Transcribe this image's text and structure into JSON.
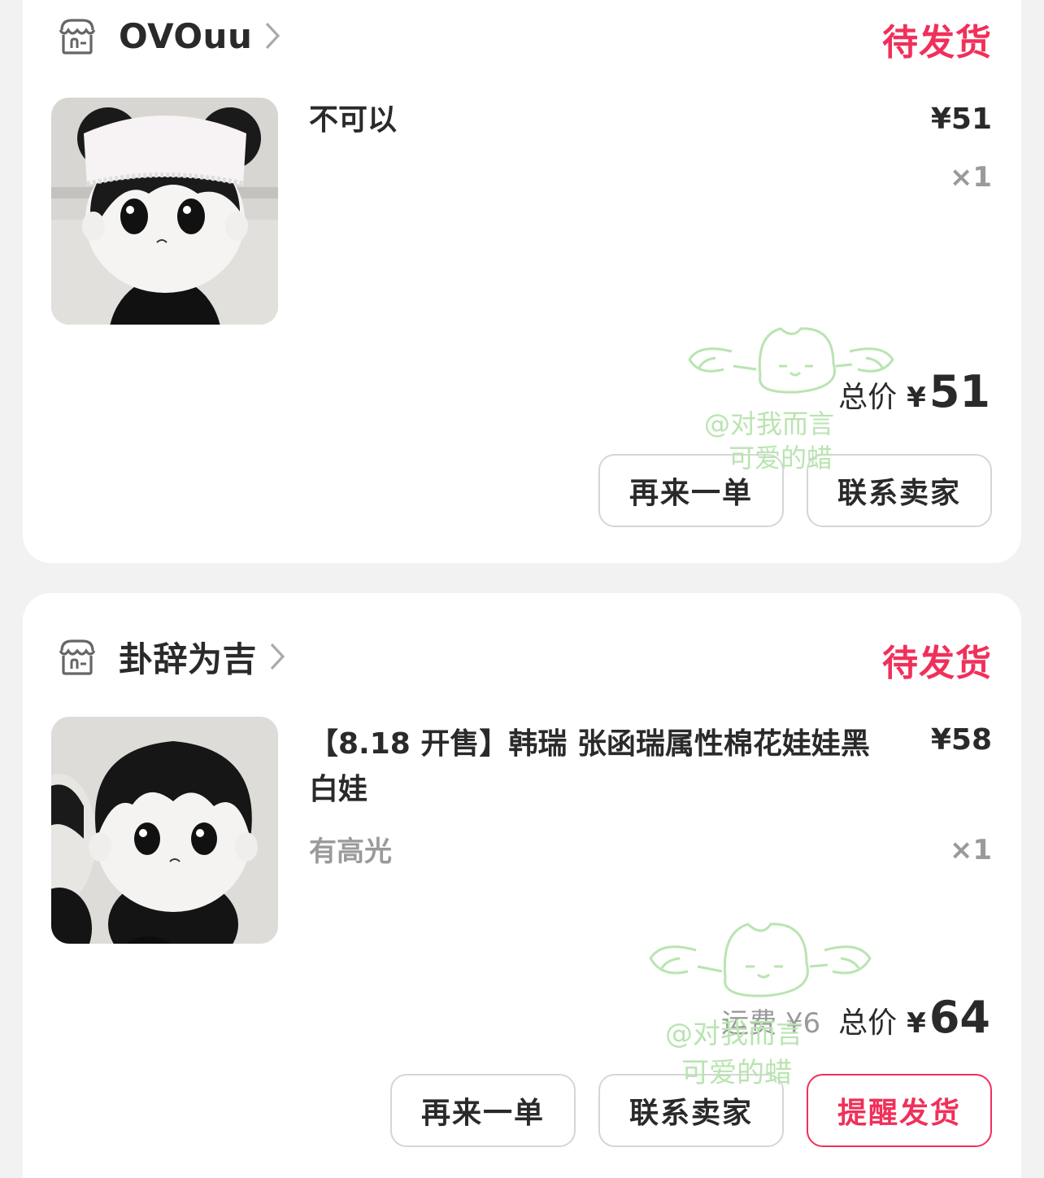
{
  "orders": [
    {
      "shop_name": "OVOuu",
      "status": "待发货",
      "item": {
        "title": "不可以",
        "spec": "",
        "price": "¥51",
        "qty": "×1"
      },
      "shipping": "",
      "total_label": "总价",
      "currency": "¥",
      "total": "51",
      "buttons": [
        "再来一单",
        "联系卖家"
      ]
    },
    {
      "shop_name": "卦辞为吉",
      "status": "待发货",
      "item": {
        "title": "【8.18 开售】韩瑞 张函瑞属性棉花娃娃黑白娃",
        "spec": "有高光",
        "price": "¥58",
        "qty": "×1"
      },
      "shipping": "运费 ¥6",
      "total_label": "总价",
      "currency": "¥",
      "total": "64",
      "buttons": [
        "再来一单",
        "联系卖家",
        "提醒发货"
      ]
    }
  ],
  "watermark": {
    "line1": "@对我而言",
    "line2": "可爱的蜡"
  },
  "colors": {
    "accent": "#f0305a",
    "watermark": "#b8e6b0"
  }
}
